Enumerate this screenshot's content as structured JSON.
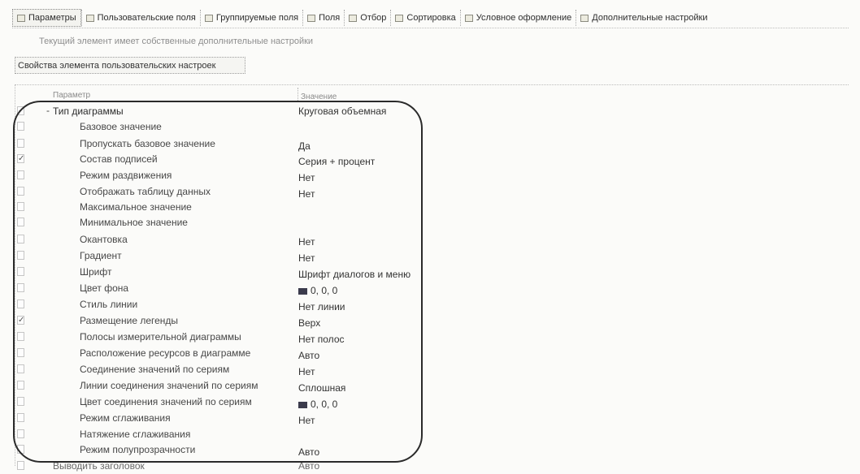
{
  "tabs": [
    {
      "label": "Параметры",
      "icon": "settings-tab-icon",
      "active": true
    },
    {
      "label": "Пользовательские поля",
      "icon": "custom-fields-tab-icon"
    },
    {
      "label": "Группируемые поля",
      "icon": "grouping-fields-tab-icon"
    },
    {
      "label": "Поля",
      "icon": "fields-tab-icon"
    },
    {
      "label": "Отбор",
      "icon": "filter-tab-icon"
    },
    {
      "label": "Сортировка",
      "icon": "sort-tab-icon"
    },
    {
      "label": "Условное оформление",
      "icon": "conditional-appearance-tab-icon"
    },
    {
      "label": "Дополнительные настройки",
      "icon": "additional-settings-tab-icon"
    }
  ],
  "info_text": "Текущий элемент имеет собственные дополнительные настройки",
  "props_button": "Свойства элемента пользовательских настроек",
  "columns": {
    "parameter": "Параметр",
    "value": "Значение"
  },
  "rows": [
    {
      "name": "Тип диаграммы",
      "value": "Круговая объемная",
      "checked": true,
      "expander": "-",
      "top": true
    },
    {
      "name": "Базовое значение",
      "value": "",
      "checked": false
    },
    {
      "name": "Пропускать базовое значение",
      "value": "Да",
      "checked": false
    },
    {
      "name": "Состав подписей",
      "value": "Серия + процент",
      "checked": true
    },
    {
      "name": "Режим раздвижения",
      "value": "Нет",
      "checked": false
    },
    {
      "name": "Отображать таблицу данных",
      "value": "Нет",
      "checked": false
    },
    {
      "name": "Максимальное значение",
      "value": "",
      "checked": false
    },
    {
      "name": "Минимальное значение",
      "value": "",
      "checked": false
    },
    {
      "name": "Окантовка",
      "value": "Нет",
      "checked": false
    },
    {
      "name": "Градиент",
      "value": "Нет",
      "checked": false
    },
    {
      "name": "Шрифт",
      "value": "Шрифт диалогов и меню",
      "checked": false
    },
    {
      "name": "Цвет фона",
      "value": "0, 0, 0",
      "checked": false,
      "swatch": "#3b3b4c"
    },
    {
      "name": "Стиль линии",
      "value": "Нет линии",
      "checked": false
    },
    {
      "name": "Размещение легенды",
      "value": "Верх",
      "checked": true
    },
    {
      "name": "Полосы измерительной диаграммы",
      "value": "Нет полос",
      "checked": false
    },
    {
      "name": "Расположение ресурсов в диаграмме",
      "value": "Авто",
      "checked": false
    },
    {
      "name": "Соединение значений по сериям",
      "value": "Нет",
      "checked": false
    },
    {
      "name": "Линии соединения значений по сериям",
      "value": "Сплошная",
      "checked": false
    },
    {
      "name": "Цвет соединения значений по сериям",
      "value": "0, 0, 0",
      "checked": false,
      "swatch": "#3b3b4c"
    },
    {
      "name": "Режим сглаживания",
      "value": "Нет",
      "checked": false
    },
    {
      "name": "Натяжение сглаживания",
      "value": "",
      "checked": false
    },
    {
      "name": "Режим полупрозрачности",
      "value": "Авто",
      "checked": false
    },
    {
      "name": "Выводить заголовок",
      "value": "Авто",
      "checked": false,
      "top": true,
      "last": true
    }
  ]
}
